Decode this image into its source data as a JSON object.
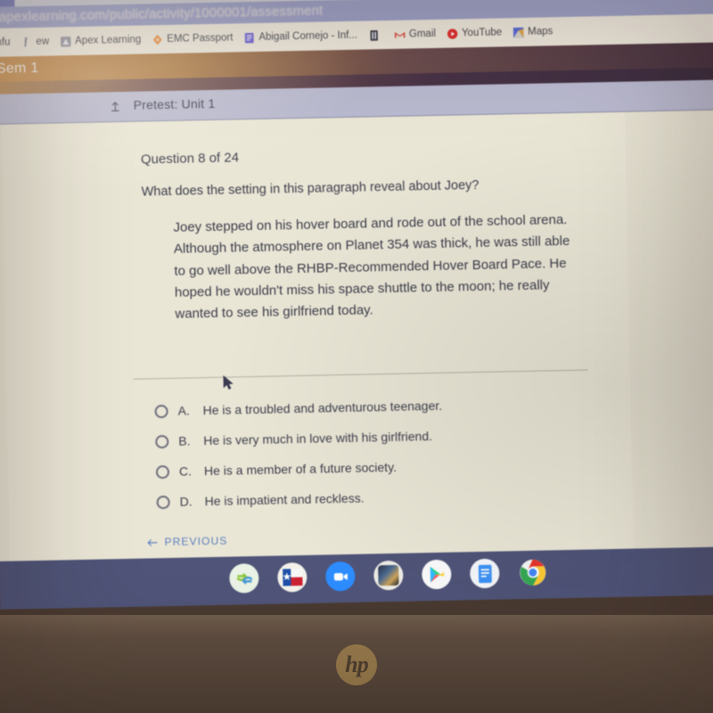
{
  "browser": {
    "url": "apexlearning.com/public/activity/1000001/assessment",
    "tab_close_label": "×",
    "new_tab_label": "+",
    "bookmarks": [
      {
        "label": "mfu",
        "icon": "generic-favicon"
      },
      {
        "label": "ew",
        "icon": "bookmark-icon"
      },
      {
        "label": "Apex Learning",
        "icon": "apex-learning-icon"
      },
      {
        "label": "EMC Passport",
        "icon": "emc-passport-icon"
      },
      {
        "label": "Abigail Cornejo - Inf...",
        "icon": "google-docs-icon"
      },
      {
        "label": "",
        "icon": "document-icon"
      },
      {
        "label": "Gmail",
        "icon": "gmail-icon"
      },
      {
        "label": "YouTube",
        "icon": "youtube-icon"
      },
      {
        "label": "Maps",
        "icon": "google-maps-icon"
      }
    ]
  },
  "site": {
    "semester_label": "Sem 1",
    "nav_title": "Pretest: Unit 1",
    "nav_icon": "up-arrow-icon"
  },
  "assessment": {
    "question_counter": "Question 8 of 24",
    "question_stem": "What does the setting in this paragraph reveal about Joey?",
    "passage": "Joey stepped on his hover board and rode out of the school arena. Although the atmosphere on Planet 354 was thick, he was still able to go well above the RHBP-Recommended Hover Board Pace. He hoped he wouldn't miss his space shuttle to the moon; he really wanted to see his girlfriend today.",
    "options": [
      {
        "letter": "A.",
        "text": "He is a troubled and adventurous teenager.",
        "selected": false
      },
      {
        "letter": "B.",
        "text": "He is very much in love with his girlfriend.",
        "selected": false
      },
      {
        "letter": "C.",
        "text": "He is a member of a future society.",
        "selected": false
      },
      {
        "letter": "D.",
        "text": "He is impatient and reckless.",
        "selected": false
      }
    ],
    "previous_label": "PREVIOUS",
    "previous_icon": "left-arrow-icon"
  },
  "shelf": {
    "apps": [
      {
        "name": "files-sync-icon"
      },
      {
        "name": "texas-flag-icon"
      },
      {
        "name": "zoom-icon"
      },
      {
        "name": "game-app-icon"
      },
      {
        "name": "google-play-icon"
      },
      {
        "name": "google-docs-icon"
      },
      {
        "name": "chrome-icon"
      }
    ]
  },
  "device": {
    "brand_logo": "hp"
  },
  "colors": {
    "link_blue": "#5b7fbe",
    "chrome_tabstrip": "#7b80b8",
    "nav_band": "#b9b9cf",
    "page_cream": "#eae6d6",
    "shelf": "#4f5478"
  }
}
